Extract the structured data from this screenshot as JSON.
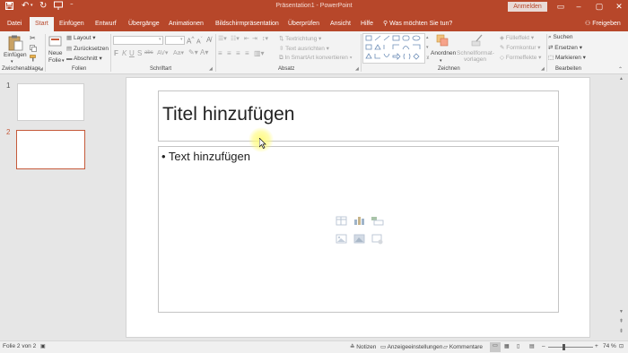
{
  "titlebar": {
    "title": "Präsentation1  -  PowerPoint",
    "signin": "Anmelden",
    "qat_more": "⁼"
  },
  "tabs": [
    "Datei",
    "Start",
    "Einfügen",
    "Entwurf",
    "Übergänge",
    "Animationen",
    "Bildschirmpräsentation",
    "Überprüfen",
    "Ansicht",
    "Hilfe"
  ],
  "tellme": "Was möchten Sie tun?",
  "share": "Freigeben",
  "ribbon": {
    "clipboard": {
      "paste": "Einfügen",
      "label": "Zwischenablage"
    },
    "slides": {
      "new_slide_1": "Neue",
      "new_slide_2": "Folie",
      "layout": "Layout",
      "reset": "Zurücksetzen",
      "section": "Abschnitt",
      "label": "Folien"
    },
    "font": {
      "label": "Schriftart",
      "bold": "F",
      "italic": "K",
      "underline": "U",
      "strike": "S",
      "shadow": "abc"
    },
    "paragraph": {
      "text_direction": "Textrichtung",
      "align_text": "Text ausrichten",
      "smartart": "In SmartArt konvertieren",
      "label": "Absatz"
    },
    "drawing": {
      "arrange": "Anordnen",
      "quick_styles_1": "Schnellformat-",
      "quick_styles_2": "vorlagen",
      "fill": "Fülleffekt",
      "outline": "Formkontur",
      "effects": "Formeffekte",
      "label": "Zeichnen"
    },
    "editing": {
      "find": "Suchen",
      "replace": "Ersetzen",
      "select": "Markieren",
      "label": "Bearbeiten"
    }
  },
  "thumbnails": [
    {
      "number": "1"
    },
    {
      "number": "2"
    }
  ],
  "slide": {
    "title_placeholder": "Titel hinzufügen",
    "body_placeholder": "• Text hinzufügen"
  },
  "statusbar": {
    "slide_info": "Folie 2 von 2",
    "notes": "Notizen",
    "display_settings": "Anzeigeeinstellungen",
    "comments": "Kommentare",
    "zoom": "74 %"
  },
  "colors": {
    "accent": "#b7472a",
    "ribbon_bg": "#f3f3f3",
    "workspace_bg": "#e6e6e6"
  }
}
